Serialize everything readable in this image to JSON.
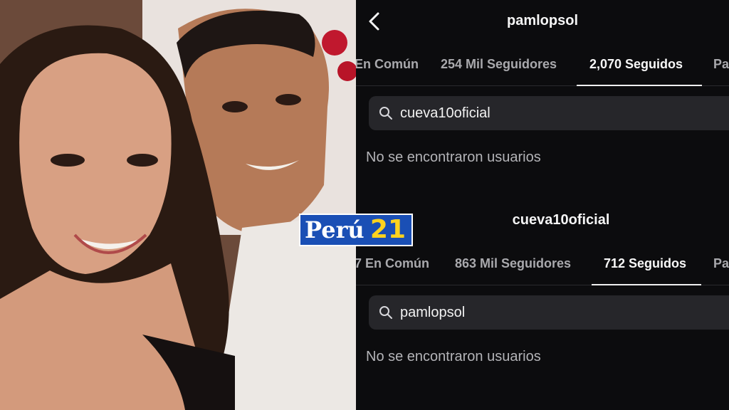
{
  "top_profile": {
    "username": "pamlopsol",
    "tabs": [
      "En Común",
      "254 Mil Seguidores",
      "2,070 Seguidos",
      "Pa"
    ],
    "active_tab": "2,070 Seguidos",
    "search_value": "cueva10oficial",
    "empty_message": "No se encontraron usuarios"
  },
  "bottom_profile": {
    "username": "cueva10oficial",
    "tabs": [
      "7 En Común",
      "863 Mil Seguidores",
      "712 Seguidos",
      "Pa"
    ],
    "active_tab": "712 Seguidos",
    "search_value": "pamlopsol",
    "empty_message": "No se encontraron usuarios"
  },
  "logo": {
    "part_a": "Perú",
    "part_b": "21"
  },
  "colors": {
    "panel_bg": "#0c0c0e",
    "search_bg": "#26262a",
    "logo_blue": "#1a4fb5",
    "logo_yellow": "#ffd21e"
  },
  "icons": [
    "back-arrow-icon",
    "search-icon"
  ]
}
